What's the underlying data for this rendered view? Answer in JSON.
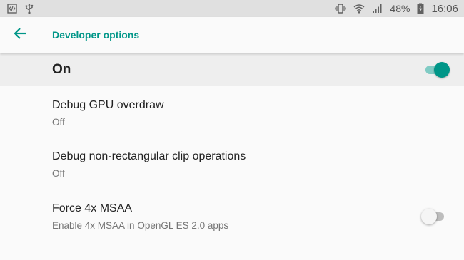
{
  "status_bar": {
    "battery_percent": "48%",
    "time": "16:06",
    "icons_left": [
      "developer-code-icon",
      "usb-icon"
    ],
    "icons_right": [
      "vibrate-icon",
      "wifi-icon",
      "cell-signal-icon",
      "battery-charging-icon"
    ]
  },
  "app_bar": {
    "back_icon": "arrow-back-icon",
    "title": "Developer options"
  },
  "master_switch": {
    "label": "On",
    "state": "on"
  },
  "settings": [
    {
      "title": "Debug GPU overdraw",
      "summary": "Off"
    },
    {
      "title": "Debug non-rectangular clip operations",
      "summary": "Off"
    },
    {
      "title": "Force 4x MSAA",
      "summary": "Enable 4x MSAA in OpenGL ES 2.0 apps",
      "toggle": "off"
    }
  ],
  "colors": {
    "accent": "#009688",
    "accent_light": "#80cbc4",
    "status_bar_bg": "#e0e0e0",
    "master_bar_bg": "#eeeeee",
    "page_bg": "#fafafa"
  }
}
